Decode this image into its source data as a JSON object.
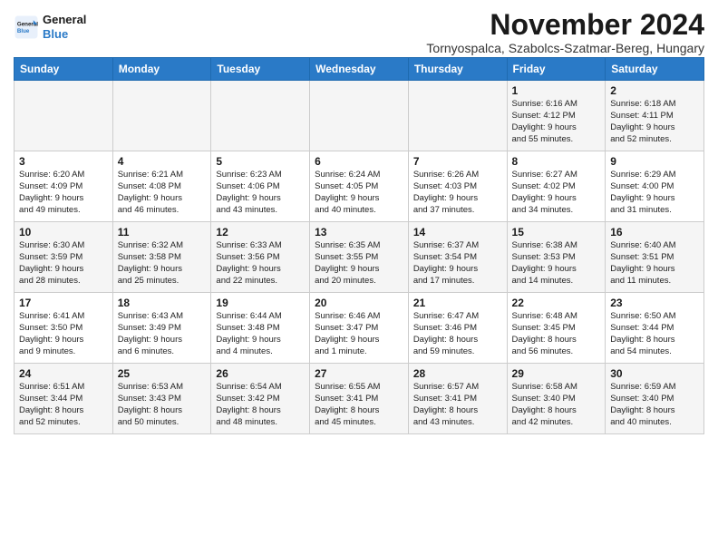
{
  "header": {
    "logo_line1": "General",
    "logo_line2": "Blue",
    "month_title": "November 2024",
    "subtitle": "Tornyospalca, Szabolcs-Szatmar-Bereg, Hungary"
  },
  "weekdays": [
    "Sunday",
    "Monday",
    "Tuesday",
    "Wednesday",
    "Thursday",
    "Friday",
    "Saturday"
  ],
  "weeks": [
    [
      {
        "day": "",
        "info": ""
      },
      {
        "day": "",
        "info": ""
      },
      {
        "day": "",
        "info": ""
      },
      {
        "day": "",
        "info": ""
      },
      {
        "day": "",
        "info": ""
      },
      {
        "day": "1",
        "info": "Sunrise: 6:16 AM\nSunset: 4:12 PM\nDaylight: 9 hours\nand 55 minutes."
      },
      {
        "day": "2",
        "info": "Sunrise: 6:18 AM\nSunset: 4:11 PM\nDaylight: 9 hours\nand 52 minutes."
      }
    ],
    [
      {
        "day": "3",
        "info": "Sunrise: 6:20 AM\nSunset: 4:09 PM\nDaylight: 9 hours\nand 49 minutes."
      },
      {
        "day": "4",
        "info": "Sunrise: 6:21 AM\nSunset: 4:08 PM\nDaylight: 9 hours\nand 46 minutes."
      },
      {
        "day": "5",
        "info": "Sunrise: 6:23 AM\nSunset: 4:06 PM\nDaylight: 9 hours\nand 43 minutes."
      },
      {
        "day": "6",
        "info": "Sunrise: 6:24 AM\nSunset: 4:05 PM\nDaylight: 9 hours\nand 40 minutes."
      },
      {
        "day": "7",
        "info": "Sunrise: 6:26 AM\nSunset: 4:03 PM\nDaylight: 9 hours\nand 37 minutes."
      },
      {
        "day": "8",
        "info": "Sunrise: 6:27 AM\nSunset: 4:02 PM\nDaylight: 9 hours\nand 34 minutes."
      },
      {
        "day": "9",
        "info": "Sunrise: 6:29 AM\nSunset: 4:00 PM\nDaylight: 9 hours\nand 31 minutes."
      }
    ],
    [
      {
        "day": "10",
        "info": "Sunrise: 6:30 AM\nSunset: 3:59 PM\nDaylight: 9 hours\nand 28 minutes."
      },
      {
        "day": "11",
        "info": "Sunrise: 6:32 AM\nSunset: 3:58 PM\nDaylight: 9 hours\nand 25 minutes."
      },
      {
        "day": "12",
        "info": "Sunrise: 6:33 AM\nSunset: 3:56 PM\nDaylight: 9 hours\nand 22 minutes."
      },
      {
        "day": "13",
        "info": "Sunrise: 6:35 AM\nSunset: 3:55 PM\nDaylight: 9 hours\nand 20 minutes."
      },
      {
        "day": "14",
        "info": "Sunrise: 6:37 AM\nSunset: 3:54 PM\nDaylight: 9 hours\nand 17 minutes."
      },
      {
        "day": "15",
        "info": "Sunrise: 6:38 AM\nSunset: 3:53 PM\nDaylight: 9 hours\nand 14 minutes."
      },
      {
        "day": "16",
        "info": "Sunrise: 6:40 AM\nSunset: 3:51 PM\nDaylight: 9 hours\nand 11 minutes."
      }
    ],
    [
      {
        "day": "17",
        "info": "Sunrise: 6:41 AM\nSunset: 3:50 PM\nDaylight: 9 hours\nand 9 minutes."
      },
      {
        "day": "18",
        "info": "Sunrise: 6:43 AM\nSunset: 3:49 PM\nDaylight: 9 hours\nand 6 minutes."
      },
      {
        "day": "19",
        "info": "Sunrise: 6:44 AM\nSunset: 3:48 PM\nDaylight: 9 hours\nand 4 minutes."
      },
      {
        "day": "20",
        "info": "Sunrise: 6:46 AM\nSunset: 3:47 PM\nDaylight: 9 hours\nand 1 minute."
      },
      {
        "day": "21",
        "info": "Sunrise: 6:47 AM\nSunset: 3:46 PM\nDaylight: 8 hours\nand 59 minutes."
      },
      {
        "day": "22",
        "info": "Sunrise: 6:48 AM\nSunset: 3:45 PM\nDaylight: 8 hours\nand 56 minutes."
      },
      {
        "day": "23",
        "info": "Sunrise: 6:50 AM\nSunset: 3:44 PM\nDaylight: 8 hours\nand 54 minutes."
      }
    ],
    [
      {
        "day": "24",
        "info": "Sunrise: 6:51 AM\nSunset: 3:44 PM\nDaylight: 8 hours\nand 52 minutes."
      },
      {
        "day": "25",
        "info": "Sunrise: 6:53 AM\nSunset: 3:43 PM\nDaylight: 8 hours\nand 50 minutes."
      },
      {
        "day": "26",
        "info": "Sunrise: 6:54 AM\nSunset: 3:42 PM\nDaylight: 8 hours\nand 48 minutes."
      },
      {
        "day": "27",
        "info": "Sunrise: 6:55 AM\nSunset: 3:41 PM\nDaylight: 8 hours\nand 45 minutes."
      },
      {
        "day": "28",
        "info": "Sunrise: 6:57 AM\nSunset: 3:41 PM\nDaylight: 8 hours\nand 43 minutes."
      },
      {
        "day": "29",
        "info": "Sunrise: 6:58 AM\nSunset: 3:40 PM\nDaylight: 8 hours\nand 42 minutes."
      },
      {
        "day": "30",
        "info": "Sunrise: 6:59 AM\nSunset: 3:40 PM\nDaylight: 8 hours\nand 40 minutes."
      }
    ]
  ]
}
